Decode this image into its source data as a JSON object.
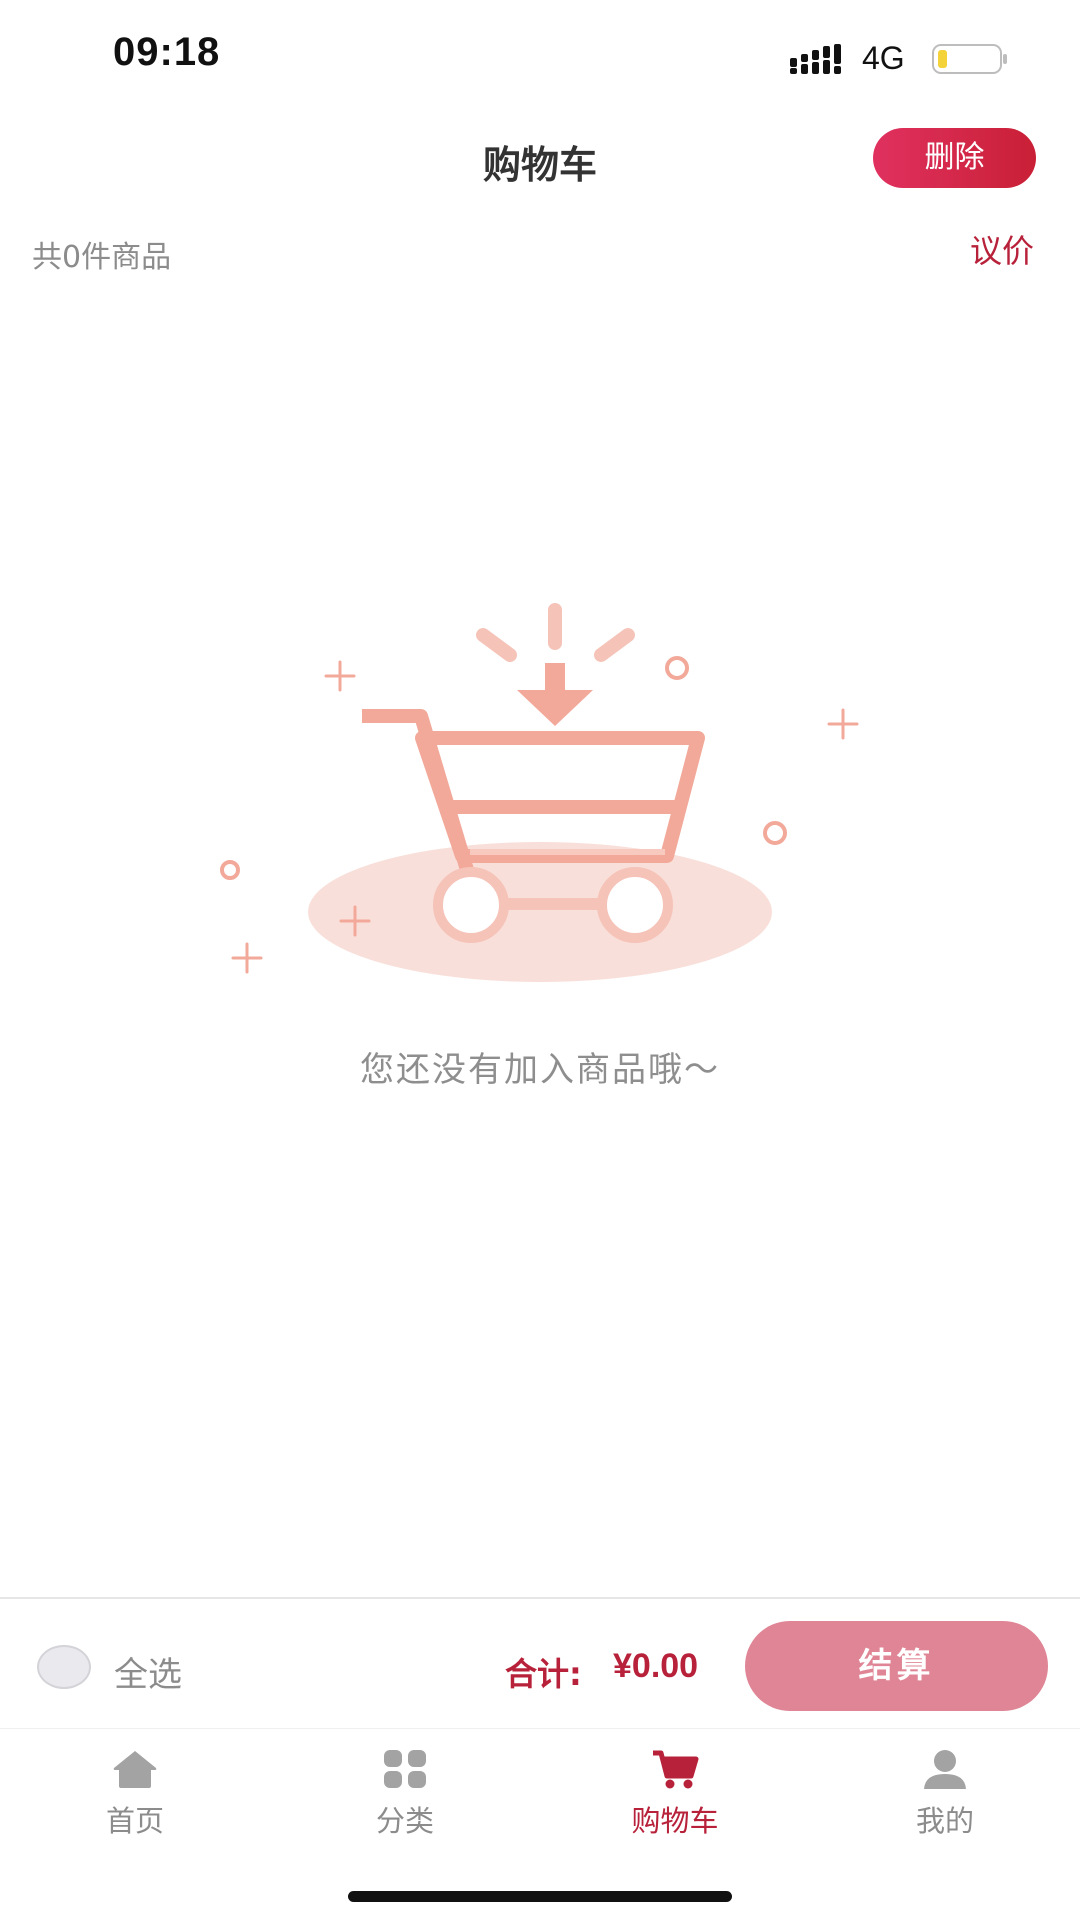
{
  "status_bar": {
    "time": "09:18",
    "network": "4G",
    "signal_icon": "signal-bars-icon",
    "battery_icon": "battery-low-icon"
  },
  "header": {
    "title": "购物车",
    "delete_label": "删除"
  },
  "subheader": {
    "item_count": "共0件商品",
    "negotiate_label": "议价"
  },
  "empty_state": {
    "icon": "empty-cart-icon",
    "message": "您还没有加入商品哦～"
  },
  "checkout": {
    "select_all_label": "全选",
    "total_label": "合计:",
    "total_amount": "¥0.00",
    "checkout_label": "结算"
  },
  "tabbar": {
    "tabs": [
      {
        "label": "首页",
        "icon": "home-icon",
        "active": false
      },
      {
        "label": "分类",
        "icon": "category-icon",
        "active": false
      },
      {
        "label": "购物车",
        "icon": "cart-icon",
        "active": true
      },
      {
        "label": "我的",
        "icon": "user-icon",
        "active": false
      }
    ]
  },
  "colors": {
    "accent": "#b8213a",
    "delete_button": "#d7264a",
    "checkout_button": "#df8595",
    "illustration": "#f2a99a",
    "muted_text": "#8c8c8c"
  }
}
